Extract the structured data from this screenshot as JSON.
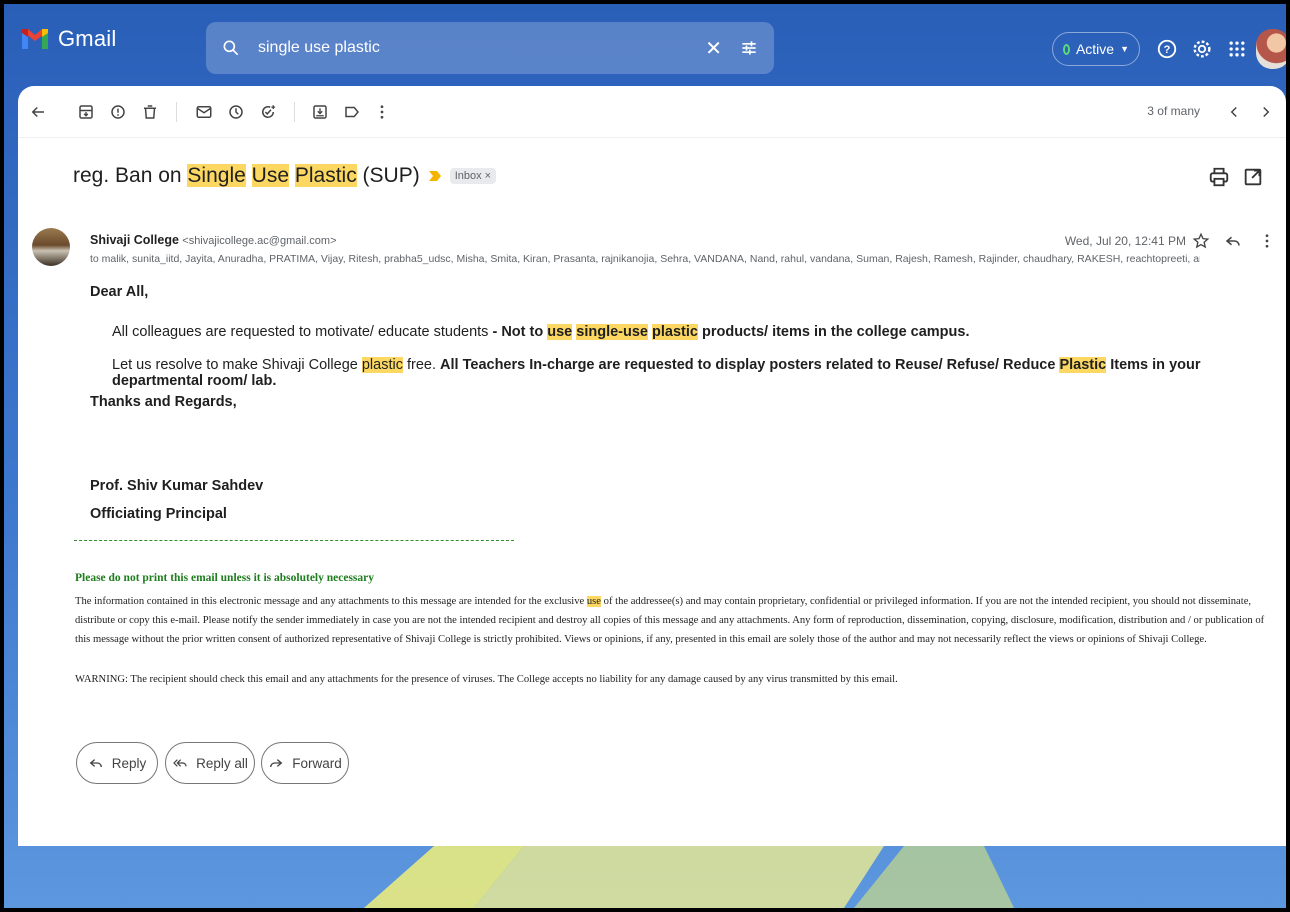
{
  "app": {
    "name": "Gmail"
  },
  "search": {
    "query": "single use plastic"
  },
  "status": {
    "label": "Active",
    "color": "#5bd97a"
  },
  "pager": {
    "text": "3 of many"
  },
  "email": {
    "subject": {
      "prefix": "reg. Ban on ",
      "hl1": "Single",
      "hl2": "Use",
      "hl3": "Plastic",
      "suffix": " (SUP)"
    },
    "label_chip": "Inbox ×",
    "sender": {
      "name": "Shivaji College",
      "email": "<shivajicollege.ac@gmail.com>"
    },
    "date": "Wed, Jul 20, 12:41 PM",
    "to": "to malik, sunita_iitd, Jayita, Anuradha, PRATIMA, Vijay, Ritesh, prabha5_udsc, Misha, Smita, Kiran, Prasanta, rajnikanojia, Sehra, VANDANA, Nand, rahul, vandana, Suman, Rajesh, Ramesh, Rajinder, chaudhary, RAKESH, reachtopreeti, anshuatulchopra, Mamta",
    "greeting": "Dear All,",
    "para1": {
      "a": "All colleagues are requested to motivate/ educate students ",
      "b": "- Not to ",
      "hl_use": "use",
      "hl_single": "single-use",
      "hl_plastic": "plastic",
      "c": " products/ items in the college campus."
    },
    "para2": {
      "a": "Let us resolve to make Shivaji College ",
      "hl_plastic": "plastic",
      "b": " free. ",
      "c": "All Teachers In-charge are requested to display posters related to Reuse/ Refuse/ Reduce ",
      "hl_plastic2": "Plastic",
      "d": " Items in your departmental room/ lab."
    },
    "closing": "Thanks and Regards,",
    "sig_name": "Prof. Shiv Kumar Sahdev",
    "sig_title": "Officiating Principal",
    "green_note": "Please do not print this email unless it is absolutely necessary",
    "disclaimer": {
      "a": "The information contained in this electronic message and any attachments to this message are intended for the exclusive ",
      "hl_use": "use",
      "b": " of the addressee(s) and may contain proprietary, confidential or privileged information. If you are not the intended recipient, you should not disseminate, distribute or copy this e-mail. Please notify the sender immediately in case you are not the intended recipient and destroy all copies of this message and any attachments. Any form of reproduction, dissemination, copying, disclosure, modification, distribution and / or publication of this message without the prior written consent of authorized representative of Shivaji College is strictly prohibited. Views or opinions, if any, presented in this email are solely those of the author and may not necessarily reflect the views or opinions of Shivaji College."
    },
    "warning": "WARNING: The recipient should check this email and any attachments for the presence of viruses. The College accepts no liability for any damage caused by any virus transmitted by this email."
  },
  "actions": {
    "reply": "Reply",
    "reply_all": "Reply all",
    "forward": "Forward"
  },
  "colors": {
    "highlight": "#fcd863",
    "header_bg": "#2a5fb8",
    "green_text": "#1e7d1e"
  }
}
